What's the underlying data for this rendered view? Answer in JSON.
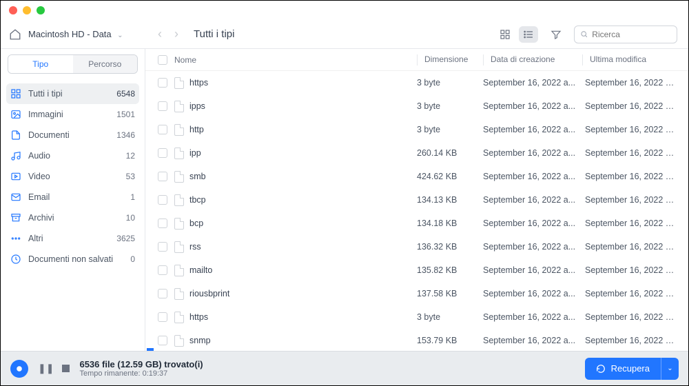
{
  "volume_name": "Macintosh HD - Data",
  "breadcrumb_title": "Tutti i tipi",
  "search_placeholder": "Ricerca",
  "segments": {
    "type": "Tipo",
    "path": "Percorso"
  },
  "sidebar": [
    {
      "icon": "grid",
      "label": "Tutti i tipi",
      "count": "6548",
      "active": true
    },
    {
      "icon": "image",
      "label": "Immagini",
      "count": "1501"
    },
    {
      "icon": "doc",
      "label": "Documenti",
      "count": "1346"
    },
    {
      "icon": "audio",
      "label": "Audio",
      "count": "12"
    },
    {
      "icon": "video",
      "label": "Video",
      "count": "53"
    },
    {
      "icon": "mail",
      "label": "Email",
      "count": "1"
    },
    {
      "icon": "archive",
      "label": "Archivi",
      "count": "10"
    },
    {
      "icon": "other",
      "label": "Altri",
      "count": "3625"
    },
    {
      "icon": "unsaved",
      "label": "Documenti non salvati",
      "count": "0"
    }
  ],
  "columns": {
    "name": "Nome",
    "size": "Dimensione",
    "created": "Data di creazione",
    "modified": "Ultima modifica"
  },
  "rows": [
    {
      "name": "https",
      "size": "3 byte",
      "created": "September 16, 2022 a...",
      "modified": "September 16, 2022 a..."
    },
    {
      "name": "ipps",
      "size": "3 byte",
      "created": "September 16, 2022 a...",
      "modified": "September 16, 2022 a..."
    },
    {
      "name": "http",
      "size": "3 byte",
      "created": "September 16, 2022 a...",
      "modified": "September 16, 2022 a..."
    },
    {
      "name": "ipp",
      "size": "260.14 KB",
      "created": "September 16, 2022 a...",
      "modified": "September 16, 2022 a..."
    },
    {
      "name": "smb",
      "size": "424.62 KB",
      "created": "September 16, 2022 a...",
      "modified": "September 16, 2022 a..."
    },
    {
      "name": "tbcp",
      "size": "134.13 KB",
      "created": "September 16, 2022 a...",
      "modified": "September 16, 2022 a..."
    },
    {
      "name": "bcp",
      "size": "134.18 KB",
      "created": "September 16, 2022 a...",
      "modified": "September 16, 2022 a..."
    },
    {
      "name": "rss",
      "size": "136.32 KB",
      "created": "September 16, 2022 a...",
      "modified": "September 16, 2022 a..."
    },
    {
      "name": "mailto",
      "size": "135.82 KB",
      "created": "September 16, 2022 a...",
      "modified": "September 16, 2022 a..."
    },
    {
      "name": "riousbprint",
      "size": "137.58 KB",
      "created": "September 16, 2022 a...",
      "modified": "September 16, 2022 a..."
    },
    {
      "name": "https",
      "size": "3 byte",
      "created": "September 16, 2022 a...",
      "modified": "September 16, 2022 a..."
    },
    {
      "name": "snmp",
      "size": "153.79 KB",
      "created": "September 16, 2022 a...",
      "modified": "September 16, 2022 a..."
    }
  ],
  "footer": {
    "status_line": "6536 file (12.59 GB) trovato(i)",
    "time_line": "Tempo rimanente: 0:19:37",
    "recover_label": "Recupera"
  }
}
